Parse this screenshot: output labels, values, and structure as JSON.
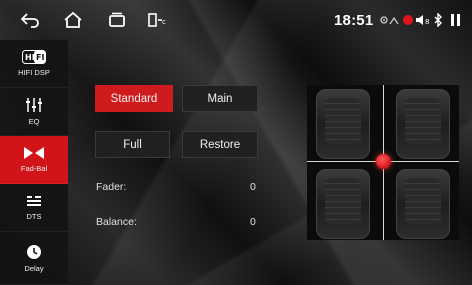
{
  "status": {
    "time": "18:51"
  },
  "sidebar": {
    "items": [
      {
        "label": "HIFI DSP",
        "icon": "hifi-icon",
        "active": false
      },
      {
        "label": "EQ",
        "icon": "equalizer-icon",
        "active": false
      },
      {
        "label": "Fad-Bal",
        "icon": "fader-balance-icon",
        "active": true
      },
      {
        "label": "DTS",
        "icon": "dts-icon",
        "active": false
      },
      {
        "label": "Delay",
        "icon": "clock-icon",
        "active": false
      }
    ]
  },
  "modes": {
    "standard": "Standard",
    "main": "Main",
    "full": "Full",
    "restore": "Restore",
    "selected": "Standard"
  },
  "levels": {
    "fader_label": "Fader:",
    "fader_value": "0",
    "balance_label": "Balance:",
    "balance_value": "0"
  },
  "colors": {
    "accent": "#cf1a1e",
    "panel": "#202020"
  }
}
